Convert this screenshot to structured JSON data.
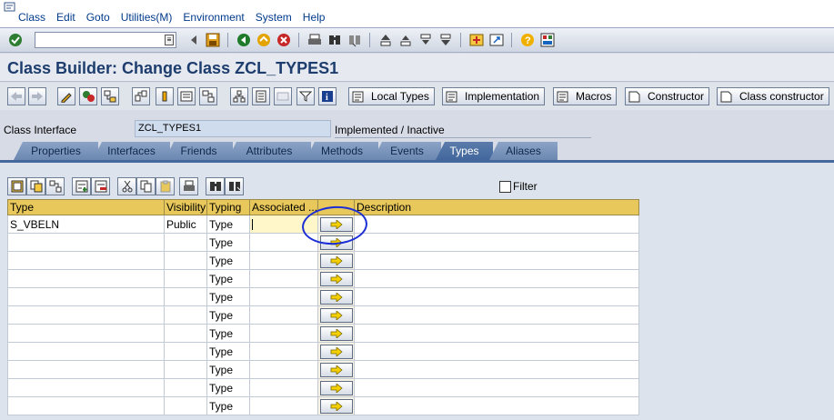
{
  "menu": [
    "Class",
    "Edit",
    "Goto",
    "Utilities(M)",
    "Environment",
    "System",
    "Help"
  ],
  "title": "Class Builder: Change Class ZCL_TYPES1",
  "app_toolbar": {
    "local_types": "Local Types",
    "implementation": "Implementation",
    "macros": "Macros",
    "constructor": "Constructor",
    "class_constructor": "Class constructor"
  },
  "class_interface": {
    "label": "Class Interface",
    "value": "ZCL_TYPES1",
    "status": "Implemented / Inactive"
  },
  "tabs": [
    "Properties",
    "Interfaces",
    "Friends",
    "Attributes",
    "Methods",
    "Events",
    "Types",
    "Aliases"
  ],
  "active_tab": "Types",
  "filter_label": "Filter",
  "table": {
    "columns": [
      "Type",
      "Visibility",
      "Typing",
      "Associated ...",
      "",
      "Description"
    ],
    "rows": [
      {
        "type": "S_VBELN",
        "visibility": "Public",
        "typing": "Type",
        "description": ""
      },
      {
        "type": "",
        "visibility": "",
        "typing": "Type",
        "description": ""
      },
      {
        "type": "",
        "visibility": "",
        "typing": "Type",
        "description": ""
      },
      {
        "type": "",
        "visibility": "",
        "typing": "Type",
        "description": ""
      },
      {
        "type": "",
        "visibility": "",
        "typing": "Type",
        "description": ""
      },
      {
        "type": "",
        "visibility": "",
        "typing": "Type",
        "description": ""
      },
      {
        "type": "",
        "visibility": "",
        "typing": "Type",
        "description": ""
      },
      {
        "type": "",
        "visibility": "",
        "typing": "Type",
        "description": ""
      },
      {
        "type": "",
        "visibility": "",
        "typing": "Type",
        "description": ""
      },
      {
        "type": "",
        "visibility": "",
        "typing": "Type",
        "description": ""
      },
      {
        "type": "",
        "visibility": "",
        "typing": "Type",
        "description": ""
      }
    ]
  },
  "colors": {
    "title": "#1d3d6e",
    "menu": "#003a8c",
    "tab_active": "#42679d",
    "header": "#e8c85a",
    "annotation_circle": "#1c2fd6"
  }
}
